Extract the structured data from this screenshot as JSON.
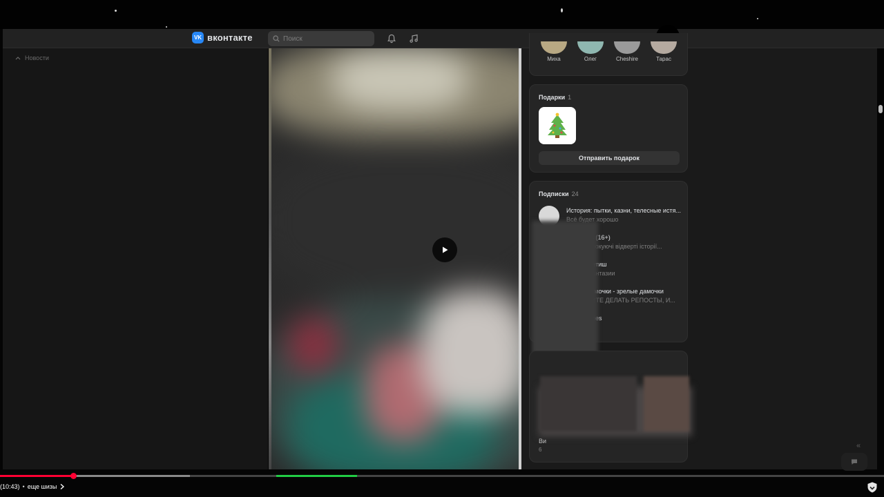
{
  "header": {
    "logo_text": "вконтакте",
    "logo_mark": "VK",
    "search_placeholder": "Поиск",
    "icons": [
      "search-icon",
      "bell-icon",
      "music-icon"
    ]
  },
  "left_nav": {
    "news_label": "Новости"
  },
  "friends": [
    {
      "name": "Миха",
      "color": "#b8a883"
    },
    {
      "name": "Олег",
      "color": "#8fb7b0"
    },
    {
      "name": "Cheshire",
      "color": "#9a9a9a"
    },
    {
      "name": "Тарас",
      "color": "#b5aaa0"
    }
  ],
  "gifts": {
    "title": "Подарки",
    "count": "1",
    "send_label": "Отправить подарок"
  },
  "subscriptions": {
    "title": "Подписки",
    "count": "24",
    "items": [
      {
        "name": "История: пытки, казни, телесные истя...",
        "desc": "Всё будет хорошо"
      },
      {
        "name": "ль (16+)",
        "desc": "і шокуючі відверті історії..."
      },
      {
        "name": "фетиш",
        "desc": "фантазии"
      },
      {
        "name": "дамочки - зрелые дамочки",
        "desc": "АЙТЕ ДЕЛАТЬ РЕПОСТЫ, И..."
      },
      {
        "name": "otties",
        "desc": ""
      }
    ]
  },
  "photos_card": {
    "label_fragment": "Ви",
    "count_fragment": "6"
  },
  "player": {
    "time": "(10:43)",
    "separator": "•",
    "chapter": "еще шизы",
    "played_fraction": 0.083,
    "buffered_fraction": 0.215
  },
  "colors": {
    "accent": "#2787f5",
    "progress": "#ff0033",
    "background": "#161616"
  }
}
